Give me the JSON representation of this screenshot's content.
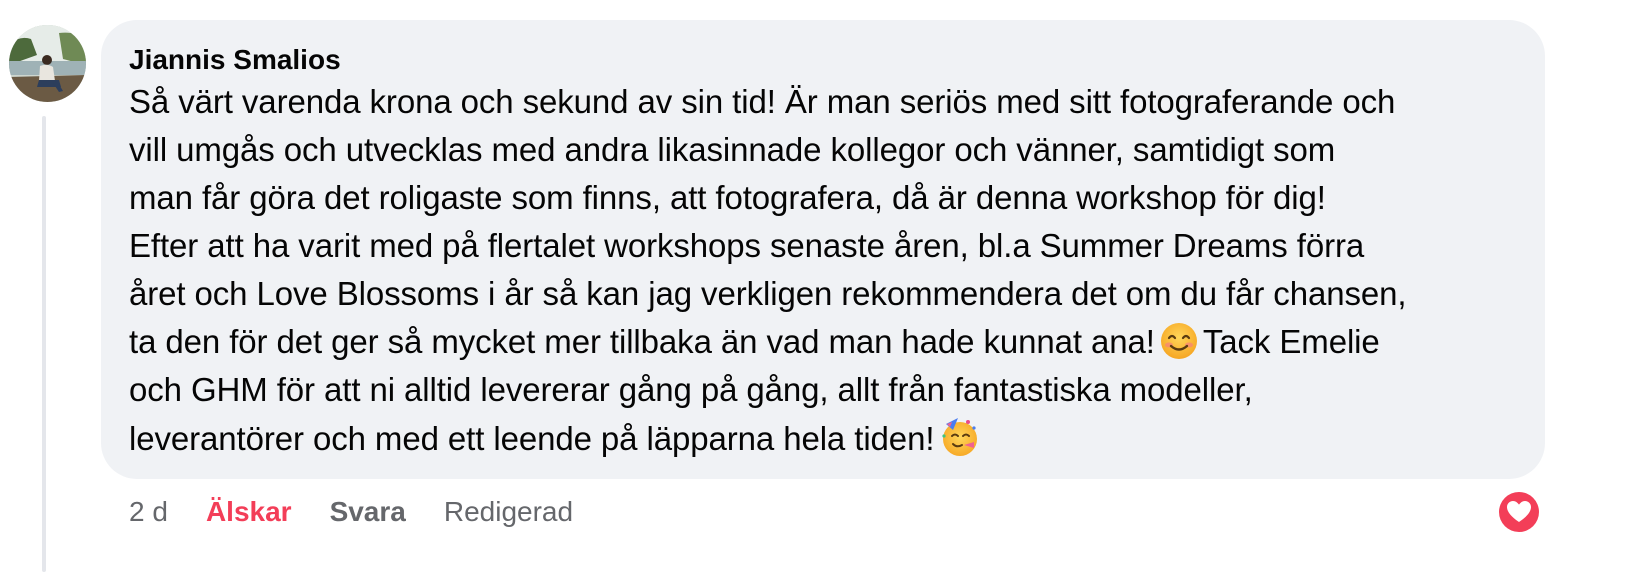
{
  "comment": {
    "author": "Jiannis Smalios",
    "lines": [
      "Så värt varenda krona och sekund av sin tid! Är man seriös med sitt fotograferande och",
      "vill umgås och utvecklas med andra likasinnade kollegor och vänner, samtidigt som",
      "man får göra det roligaste som finns, att fotografera, då är denna workshop för dig!",
      "Efter att ha varit med på flertalet workshops senaste åren, bl.a Summer Dreams förra",
      "året och Love Blossoms i år så kan jag verkligen rekommendera det om du får chansen,"
    ],
    "line6_before": "ta den för det ger så mycket mer tillbaka än vad man hade kunnat ana!",
    "line6_after": "Tack Emelie",
    "line7": "och GHM för att ni alltid levererar gång på gång, allt från fantastiska modeller,",
    "line8": "leverantörer och med ett leende på läpparna hela tiden!",
    "emoji_1": "smiling-face-icon",
    "emoji_2": "partying-face-icon"
  },
  "actions": {
    "time": "2 d",
    "love_label": "Älskar",
    "reply_label": "Svara",
    "edited_label": "Redigerad"
  },
  "reaction": {
    "icon": "heart-icon",
    "color": "#f33e58"
  },
  "colors": {
    "bubble": "#f0f2f5",
    "text": "#050505",
    "secondary": "#65676b",
    "love": "#f33e58"
  }
}
